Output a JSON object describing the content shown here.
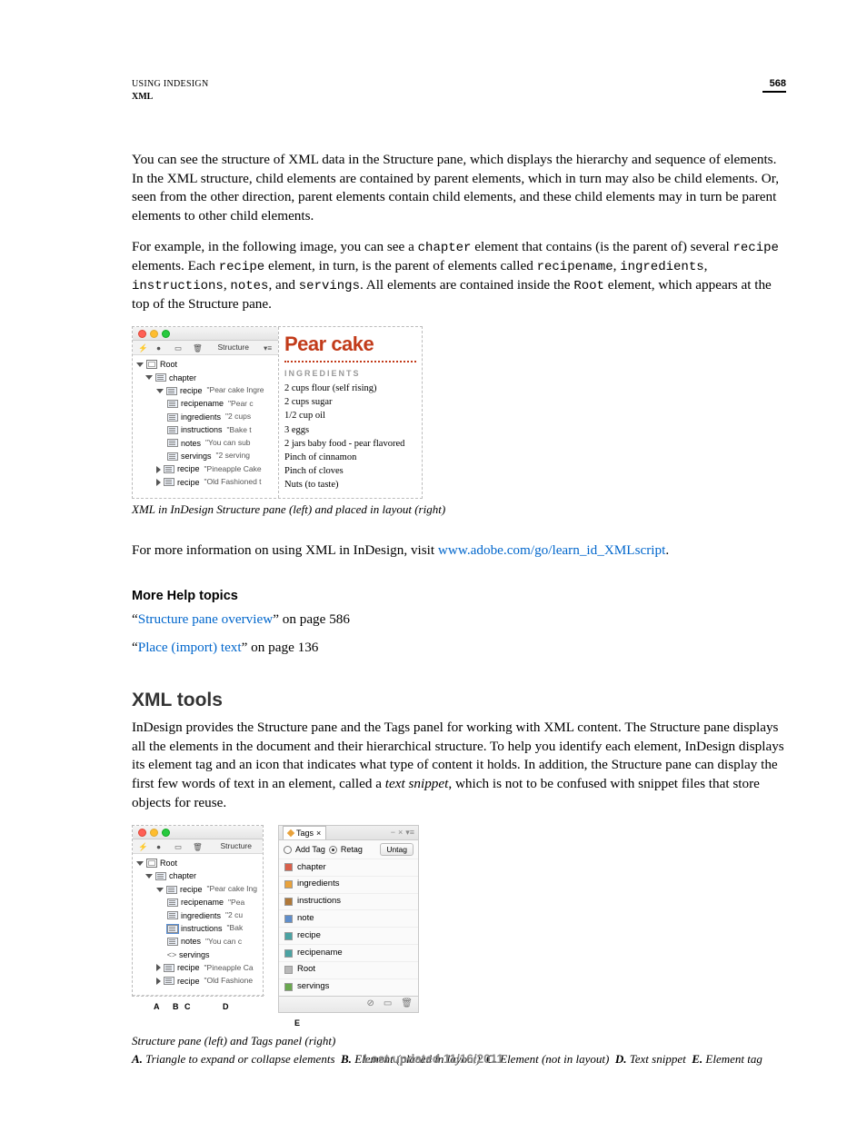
{
  "header": {
    "line1": "USING INDESIGN",
    "line2": "XML",
    "page_number": "568"
  },
  "para1": "You can see the structure of XML data in the Structure pane, which displays the hierarchy and sequence of elements. In the XML structure, child elements are contained by parent elements, which in turn may also be child elements. Or, seen from the other direction, parent elements contain child elements, and these child elements may in turn be parent elements to other child elements.",
  "para2": {
    "t1": "For example, in the following image, you can see a ",
    "c1": "chapter",
    "t2": " element that contains (is the parent of) several ",
    "c2": "recipe",
    "t3": " elements. Each ",
    "c3": "recipe",
    "t4": " element, in turn, is the parent of elements called ",
    "c4": "recipename",
    "t5": ", ",
    "c5": "ingredients",
    "t6": ", ",
    "c6": "instructions",
    "t7": ", ",
    "c7": "notes",
    "t8": ", and ",
    "c8": "servings",
    "t9": ". All elements are contained inside the ",
    "c9": "Root",
    "t10": " element, which appears at the top of the Structure pane."
  },
  "figure1": {
    "structure_title": "Structure",
    "tree": {
      "root": "Root",
      "chapter": "chapter",
      "recipe1": {
        "name": "recipe",
        "snippet": "\"Pear cake Ingre"
      },
      "recipename": {
        "name": "recipename",
        "snippet": "\"Pear c"
      },
      "ingredients": {
        "name": "ingredients",
        "snippet": "\"2 cups"
      },
      "instructions": {
        "name": "instructions",
        "snippet": "\"Bake t"
      },
      "notes": {
        "name": "notes",
        "snippet": "\"You can sub"
      },
      "servings": {
        "name": "servings",
        "snippet": "\"2 serving"
      },
      "recipe2": {
        "name": "recipe",
        "snippet": "\"Pineapple Cake"
      },
      "recipe3": {
        "name": "recipe",
        "snippet": "\"Old Fashioned t"
      }
    },
    "layout": {
      "title": "Pear cake",
      "ingredients_label": "INGREDIENTS",
      "lines": [
        "2 cups flour (self rising)",
        "2 cups sugar",
        "1/2 cup oil",
        "3 eggs",
        "2 jars baby food - pear flavored",
        "Pinch of cinnamon",
        "Pinch of cloves",
        "Nuts (to taste)"
      ]
    },
    "caption": "XML in InDesign Structure pane (left) and placed in layout (right)"
  },
  "para3": {
    "t1": "For more information on using XML in InDesign, visit ",
    "link": "www.adobe.com/go/learn_id_XMLscript",
    "t2": "."
  },
  "more_help": {
    "heading": "More Help topics",
    "line1": {
      "q1": "“",
      "link": "Structure pane overview",
      "q2": "” on page 586"
    },
    "line2": {
      "q1": "“",
      "link": "Place (import) text",
      "q2": "” on page 136"
    }
  },
  "xml_tools": {
    "heading": "XML tools",
    "para_a": "InDesign provides the Structure pane and the Tags panel for working with XML content. The Structure pane displays all the elements in the document and their hierarchical structure. To help you identify each element, InDesign displays its element tag and an icon that indicates what type of content it holds. In addition, the Structure pane can display the first few words of text in an element, called a ",
    "para_b_italic": "text snippet",
    "para_c": ", which is not to be confused with snippet files that store objects for reuse."
  },
  "figure2": {
    "structure_title": "Structure",
    "tree": {
      "root": "Root",
      "chapter": "chapter",
      "recipe1": {
        "name": "recipe",
        "snippet": "\"Pear cake Ing"
      },
      "recipename": {
        "name": "recipename",
        "snippet": "\"Pea"
      },
      "ingredients": {
        "name": "ingredients",
        "snippet": "\"2 cu"
      },
      "instructions": {
        "name": "instructions",
        "snippet": "\"Bak"
      },
      "notes": {
        "name": "notes",
        "snippet": "\"You can c"
      },
      "servings": {
        "name": "servings"
      },
      "recipe2": {
        "name": "recipe",
        "snippet": "\"Pineapple Ca"
      },
      "recipe3": {
        "name": "recipe",
        "snippet": "\"Old Fashione"
      }
    },
    "tags_panel": {
      "tab_label": "Tags",
      "add_tag": "Add Tag",
      "retag": "Retag",
      "untag": "Untag",
      "tags": [
        "chapter",
        "ingredients",
        "instructions",
        "note",
        "recipe",
        "recipename",
        "Root",
        "servings"
      ]
    },
    "callouts": {
      "A": "A",
      "B": "B",
      "C": "C",
      "D": "D",
      "E": "E"
    },
    "caption1": "Structure pane (left) and Tags panel (right)",
    "caption2": {
      "A": "Triangle to expand or collapse elements",
      "B": "Element (placed in layout)",
      "C": "Element (not in layout)",
      "D": "Text snippet",
      "E": "Element tag"
    }
  },
  "footer": "Last updated 11/16/2011"
}
